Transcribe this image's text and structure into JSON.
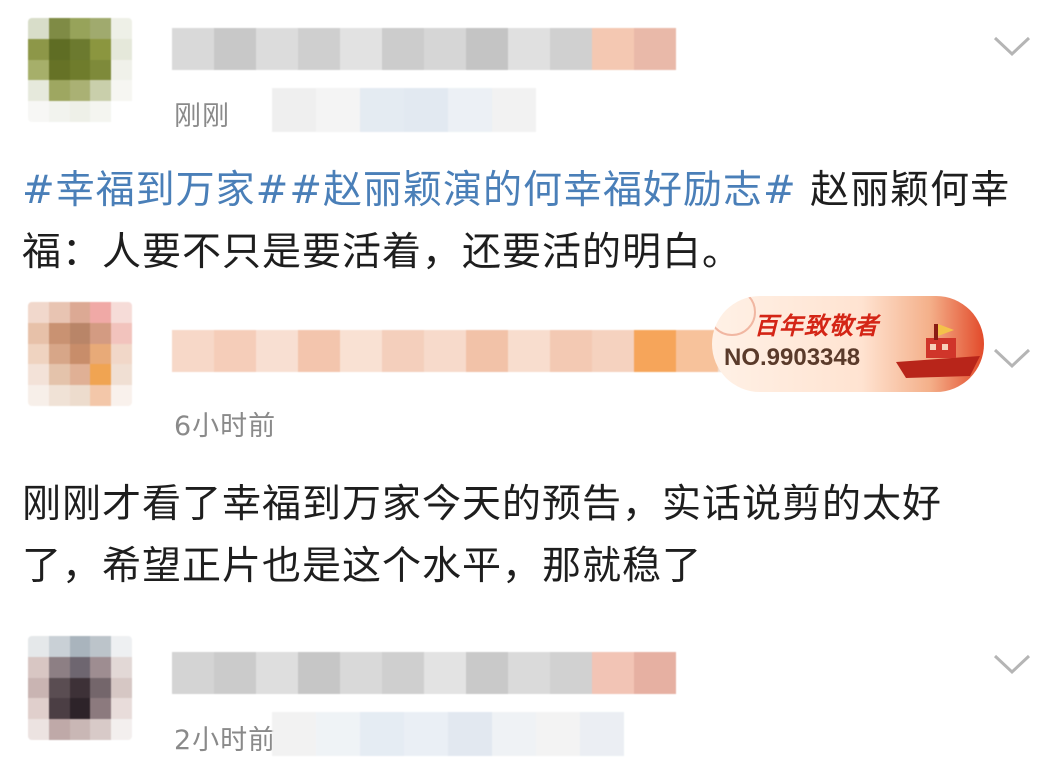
{
  "posts": [
    {
      "time": "刚刚",
      "avatar_colors": [
        "#d8ddc9",
        "#7f8b45",
        "#97a35a",
        "#a0aa6e",
        "#eef0e7",
        "#8d9748",
        "#5f6d24",
        "#6c7a2f",
        "#8b963f",
        "#e5e8da",
        "#a6af6a",
        "#667226",
        "#6f7c2c",
        "#7e8a3a",
        "#f0f1ea",
        "#e6e9dc",
        "#9ea761",
        "#aab174",
        "#c9cfab",
        "#f6f6f2",
        "#f7f7f5",
        "#f2f3ee",
        "#eef0e8",
        "#f4f5f0",
        "#ffffff"
      ],
      "name_colors": [
        "#d9d9d9",
        "#c8c8c8",
        "#dcdcdc",
        "#cfcfcf",
        "#e2e2e2",
        "#cccccc",
        "#d6d6d6",
        "#c4c4c4",
        "#e0e0e0",
        "#d0d0d0",
        "#f4c8b2",
        "#e9b9a9"
      ],
      "meta_colors": [
        "#eeeeee",
        "#f3f3f3",
        "#e2e9f1",
        "#dfe7f0",
        "#eaeff4",
        "#f1f1f1"
      ],
      "text_tags": [
        "#幸福到万家#",
        "#赵丽颖演的何幸福好励志#"
      ],
      "text_body": " 赵丽颖何幸福：人要不只是要活着，还要活的明白。"
    },
    {
      "time": "6小时前",
      "avatar_colors": [
        "#f1d8cc",
        "#e8c4b2",
        "#dca994",
        "#f0a9a6",
        "#f6dcd8",
        "#e7c1a9",
        "#c99272",
        "#b98568",
        "#d39b82",
        "#f2c3bd",
        "#efd3c0",
        "#d7a688",
        "#c88d6a",
        "#e8aa78",
        "#f1d7c8",
        "#f3e2d8",
        "#e4c3ab",
        "#e0b095",
        "#f0a452",
        "#f0dfd3",
        "#f7efe9",
        "#f0e2d6",
        "#eddccd",
        "#f3c7a9",
        "#f9f1ec"
      ],
      "name_colors": [
        "#f7d8c8",
        "#f5cdb9",
        "#f8dfd2",
        "#f3c5ad",
        "#f9e1d3",
        "#f4cfbc",
        "#f7dacb",
        "#f2c2a8",
        "#f8ddce",
        "#f3c9b3",
        "#f5d2bf",
        "#f6a55a",
        "#f7c29b",
        "#efdfd4"
      ],
      "badge": {
        "title": "百年致敬者",
        "number": "NO.9903348"
      },
      "text_body": "刚刚才看了幸福到万家今天的预告，实话说剪的太好了，希望正片也是这个水平，那就稳了"
    },
    {
      "time": "2小时前",
      "avatar_colors": [
        "#e5e8ea",
        "#c9d0d6",
        "#a9b4bd",
        "#bcc4ca",
        "#eef0f2",
        "#d8c6c3",
        "#8d7f84",
        "#6e6670",
        "#9e8d91",
        "#e2d8d6",
        "#c9b4b2",
        "#5a4d52",
        "#3d3137",
        "#74666b",
        "#d6c7c4",
        "#e0cfcc",
        "#4b3e44",
        "#2d2329",
        "#8c7a7e",
        "#e8dcda",
        "#ece3e1",
        "#bfa9a8",
        "#c9b7b5",
        "#d8cac8",
        "#f3efee"
      ],
      "name_colors": [
        "#d4d4d4",
        "#cbcbcb",
        "#dedede",
        "#c6c6c6",
        "#d9d9d9",
        "#cfcfcf",
        "#e3e3e3",
        "#c9c9c9",
        "#dadada",
        "#d1d1d1",
        "#f2c4b5",
        "#e6b0a2"
      ],
      "meta_colors": [
        "#f1f1f1",
        "#eef2f6",
        "#e3eaf2",
        "#e8eef5",
        "#dfe6ef",
        "#eef1f4",
        "#f2f2f2",
        "#e9edf2"
      ]
    }
  ]
}
